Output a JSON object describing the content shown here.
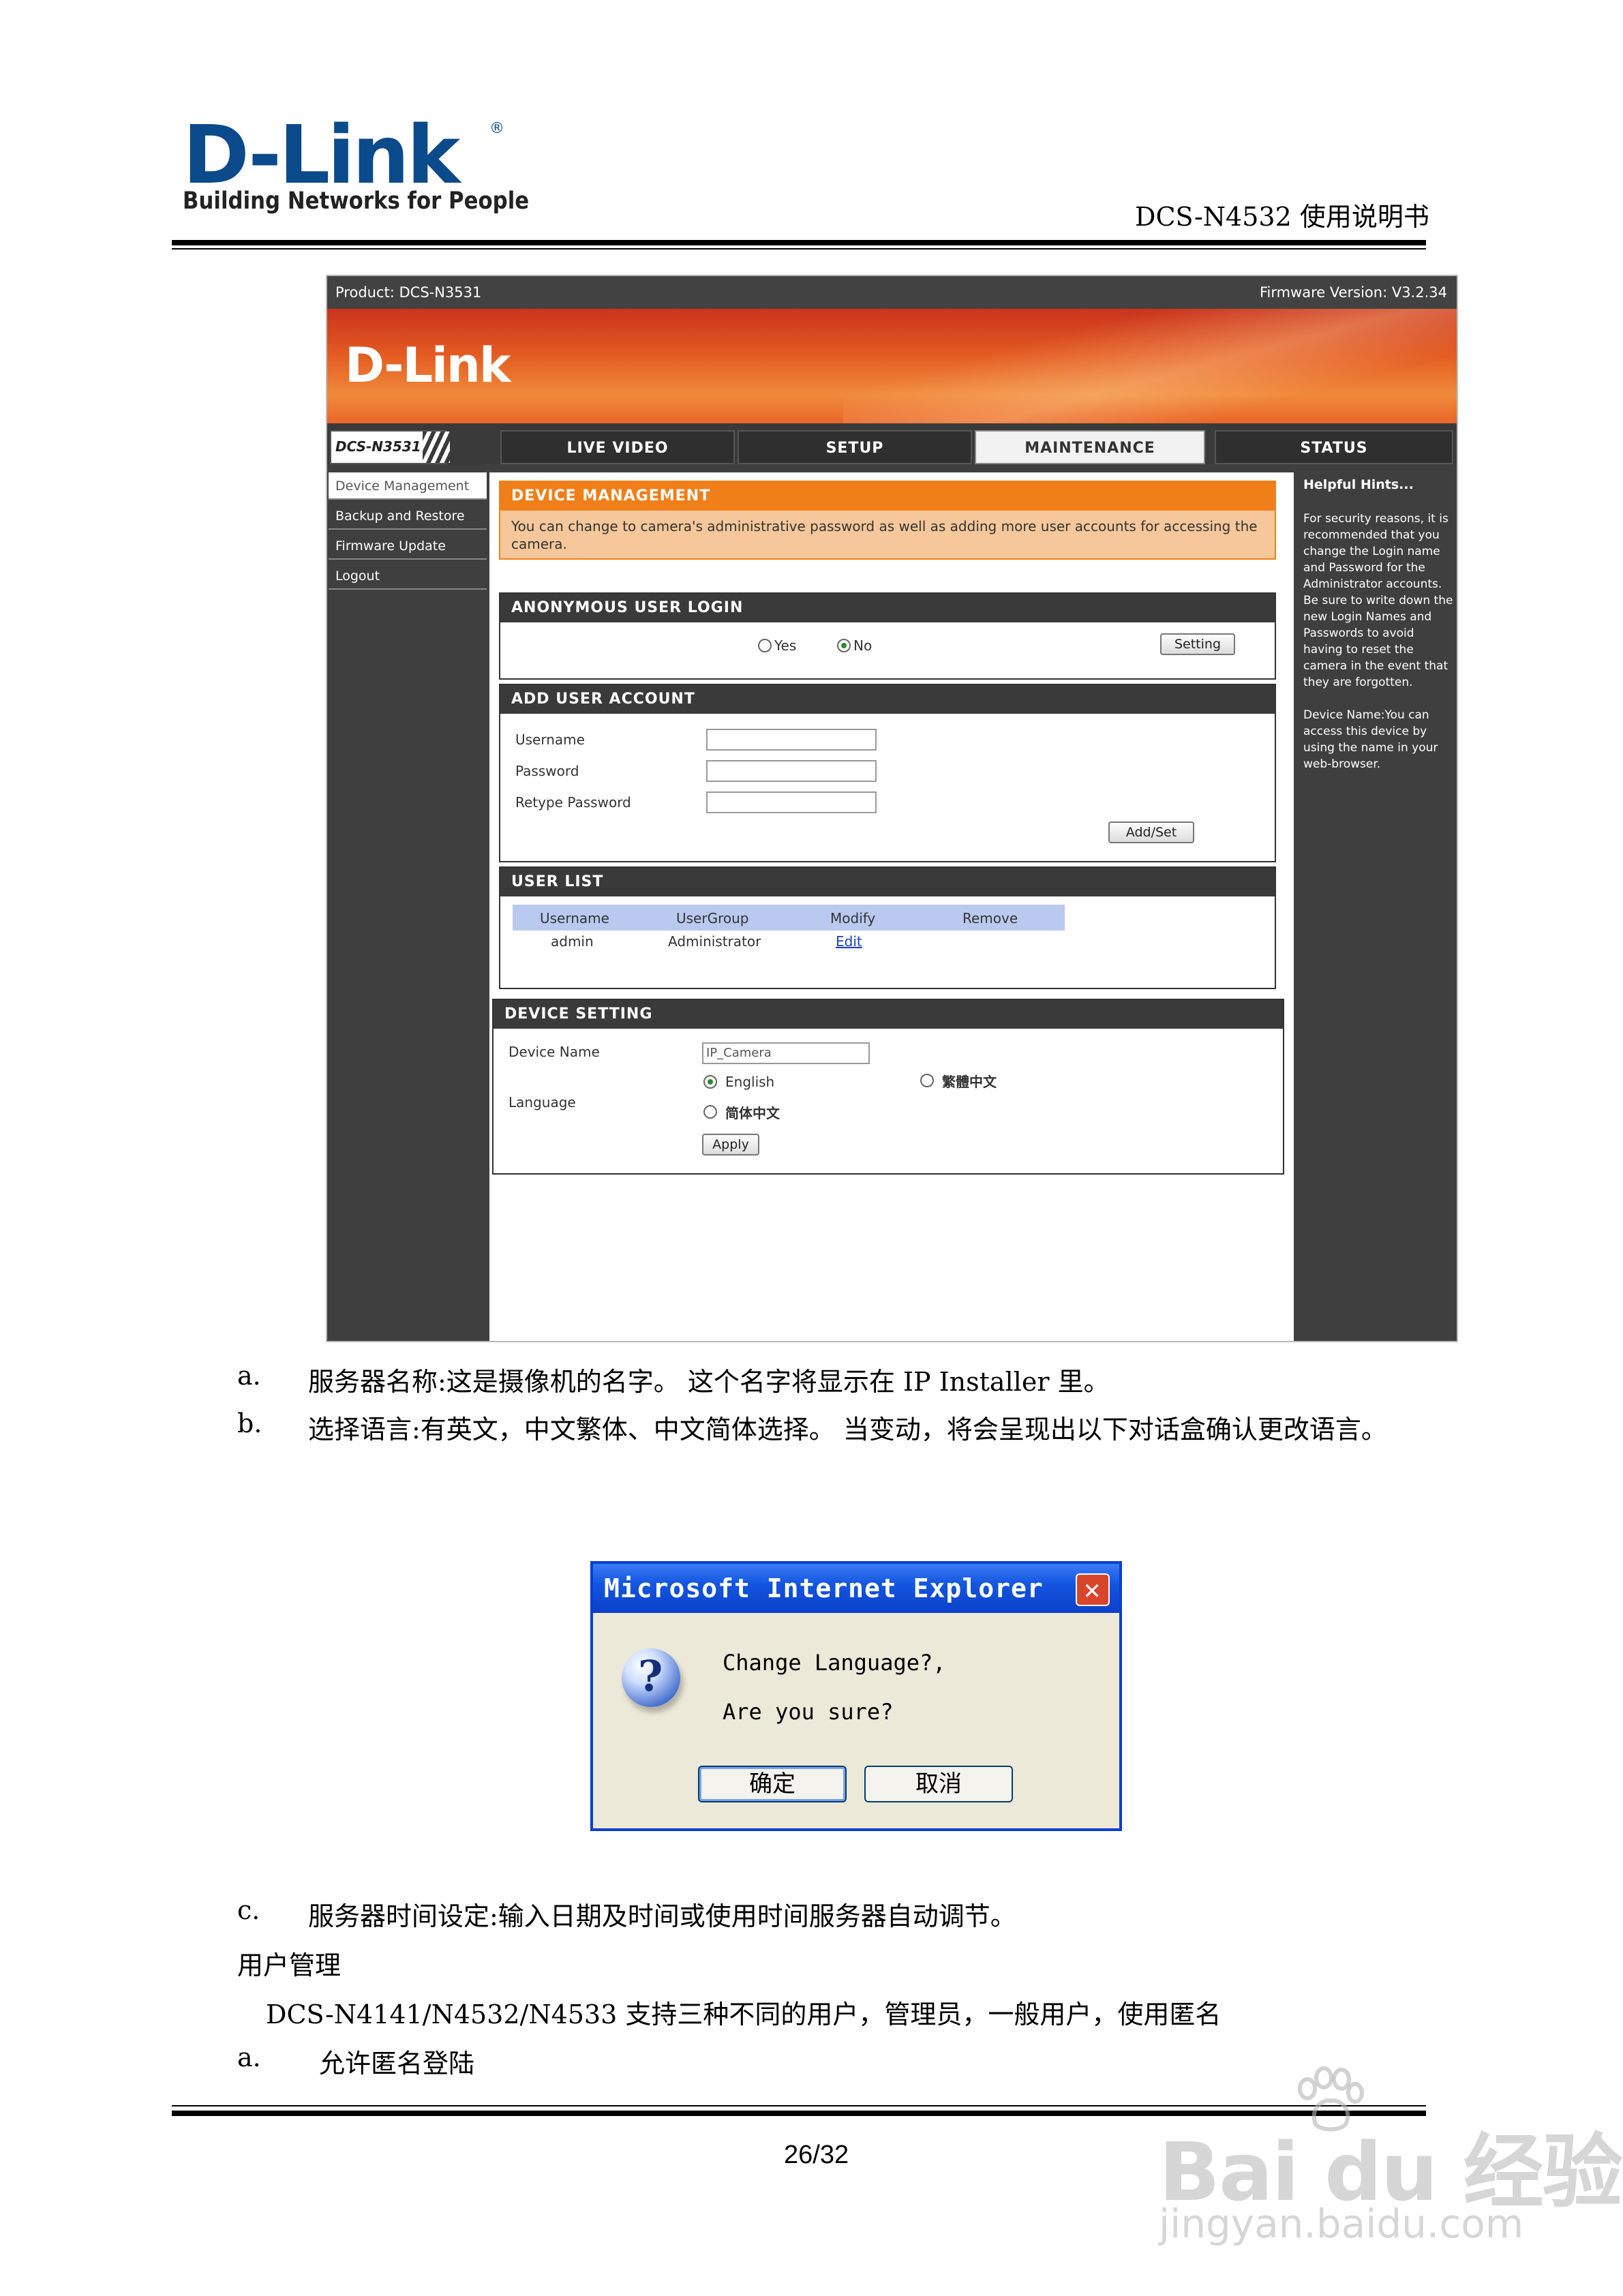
{
  "header": {
    "logo": "D-Link",
    "logo_reg": "®",
    "tagline": "Building Networks for People",
    "doc_title": "DCS-N4532 使用说明书"
  },
  "camera_ui": {
    "product": "Product: DCS-N3531",
    "firmware": "Firmware Version: V3.2.34",
    "banner_logo": "D-Link",
    "model_badge": "DCS-N3531",
    "nav": [
      "LIVE VIDEO",
      "SETUP",
      "MAINTENANCE",
      "STATUS"
    ],
    "sidebar": [
      "Device Management",
      "Backup and Restore",
      "Firmware Update",
      "Logout"
    ],
    "device_management": {
      "title": "DEVICE MANAGEMENT",
      "desc": "You can change to camera's administrative password as well as adding more user accounts for accessing the camera."
    },
    "anonymous": {
      "title": "ANONYMOUS USER LOGIN",
      "yes": "Yes",
      "no": "No",
      "setting": "Setting"
    },
    "add_user": {
      "title": "ADD USER ACCOUNT",
      "username": "Username",
      "password": "Password",
      "retype": "Retype Password",
      "button": "Add/Set"
    },
    "user_list": {
      "title": "USER LIST",
      "columns": [
        "Username",
        "UserGroup",
        "Modify",
        "Remove"
      ],
      "rows": [
        [
          "admin",
          "Administrator",
          "Edit",
          ""
        ]
      ]
    },
    "device_setting": {
      "title": "DEVICE SETTING",
      "device_name_label": "Device Name",
      "device_name_value": "IP_Camera",
      "language_label": "Language",
      "opt_english": "English",
      "opt_traditional": "繁體中文",
      "opt_simplified": "简体中文",
      "apply": "Apply"
    },
    "hints": {
      "title": "Helpful Hints...",
      "p1": "For security reasons, it is recommended that you change the Login name and Password for the Administrator accounts. Be sure to write down the new Login Names and Passwords to avoid having to reset the camera in the event that they are forgotten.",
      "p2": "Device Name:You can access this device by using the name in your web-browser."
    }
  },
  "body": {
    "a_marker": "a.",
    "a_text": "服务器名称:这是摄像机的名字。 这个名字将显示在 IP Installer 里。",
    "b_marker": "b.",
    "b_text": "选择语言:有英文，中文繁体、中文简体选择。 当变动，将会呈现出以下对话盒确认更改语言。",
    "c_marker": "c.",
    "c_text": "服务器时间设定:输入日期及时间或使用时间服务器自动调节。",
    "heading": "用户管理",
    "support": "DCS-N4141/N4532/N4533 支持三种不同的用户，管理员，一般用户，使用匿名",
    "a2_marker": "a.",
    "a2_text": "允许匿名登陆"
  },
  "dialog": {
    "title": "Microsoft Internet Explorer",
    "line1": "Change Language?,",
    "line2": "Are you sure?",
    "ok": "确定",
    "cancel": "取消"
  },
  "footer": {
    "page": "26/32"
  },
  "watermark": {
    "line1": "Bai du 经验",
    "line2": "jingyan.baidu.com"
  }
}
